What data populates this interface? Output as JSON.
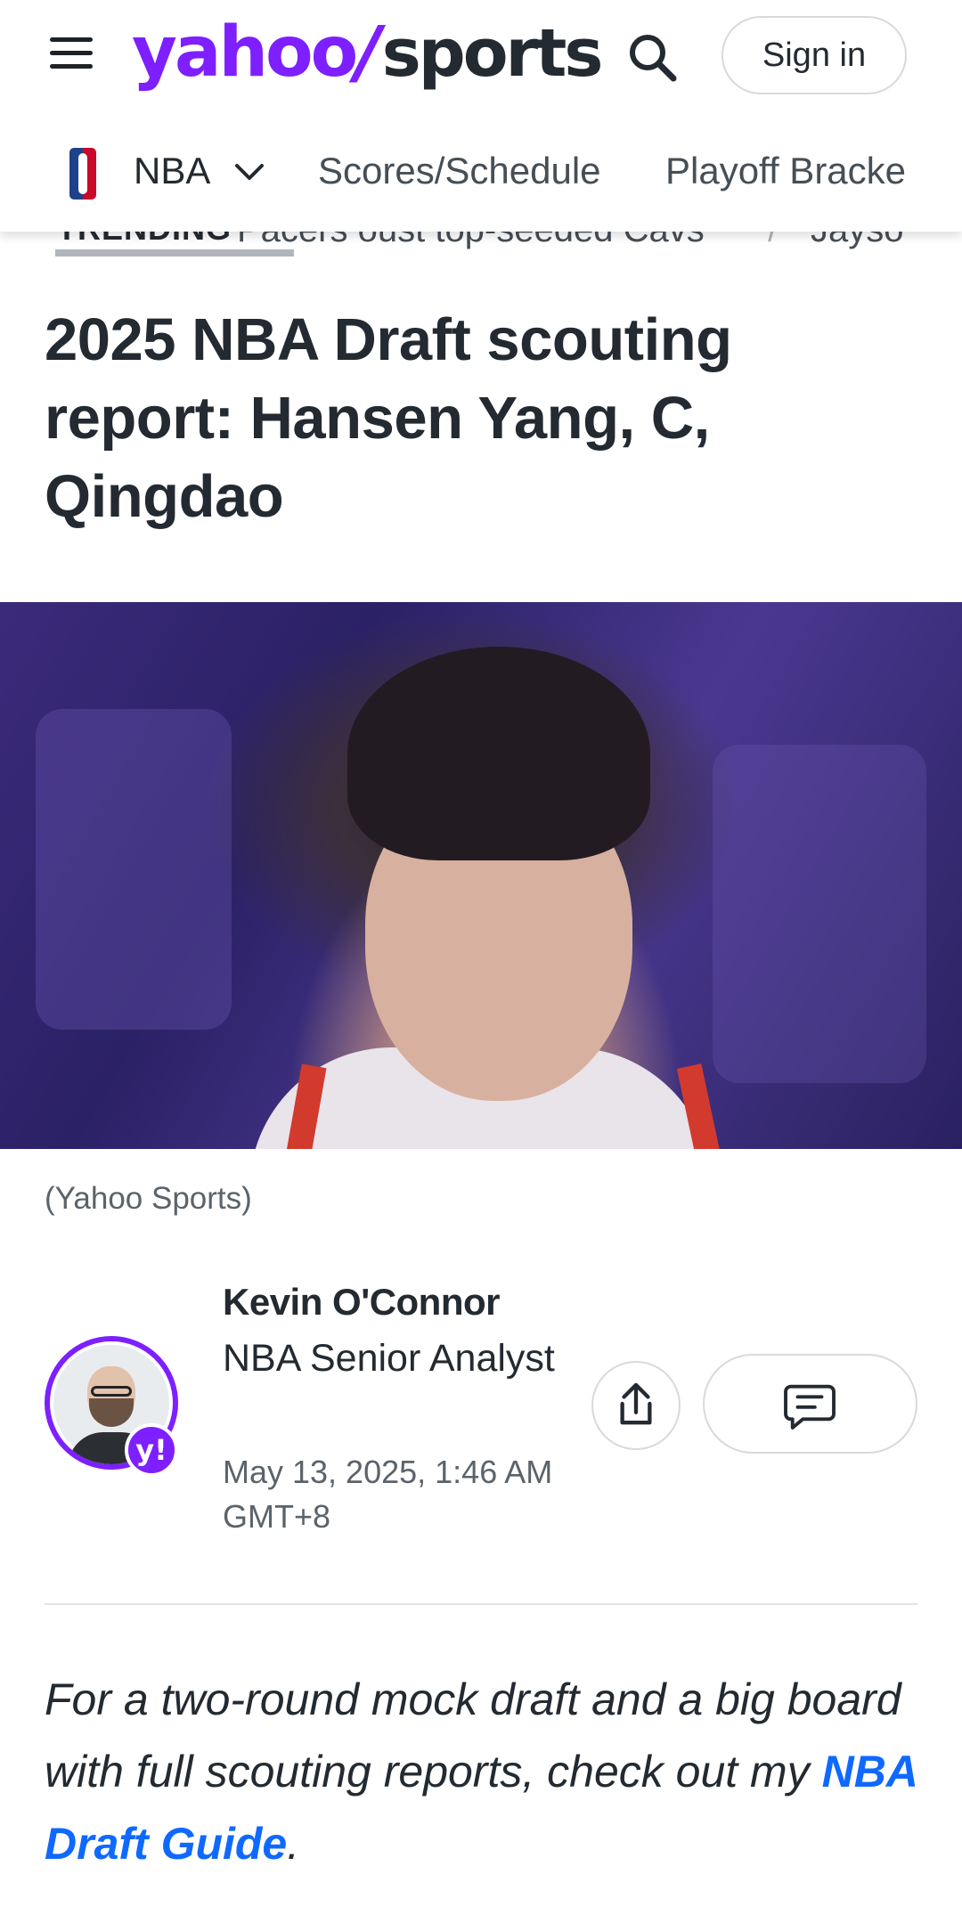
{
  "header": {
    "logo_yahoo": "yahoo",
    "logo_slash": "/",
    "logo_sports": "sports",
    "signin_label": "Sign in",
    "brand_purple": "#7e1fff"
  },
  "subnav": {
    "items": [
      {
        "label": "NBA",
        "icon": "nba-logo",
        "dropdown": true
      },
      {
        "label": "Scores/Schedule"
      },
      {
        "label": "Playoff Bracke"
      }
    ]
  },
  "trending": {
    "label": "TRENDING",
    "items": [
      "Pacers oust top-seeded Cavs",
      "Jayso"
    ]
  },
  "article": {
    "title": "2025 NBA Draft scouting report: Hansen Yang, C, Qingdao",
    "image_caption": "(Yahoo Sports)",
    "author": {
      "name": "Kevin O'Connor",
      "role": "NBA Senior Analyst",
      "badge": "y!"
    },
    "published": "May 13, 2025, 1:46 AM GMT+8",
    "intro_text_before": "For a two-round mock draft and a big board with full scouting reports, check out my ",
    "intro_link": "NBA Draft Guide",
    "intro_text_after": ".",
    "link_color": "#0f69ff"
  }
}
